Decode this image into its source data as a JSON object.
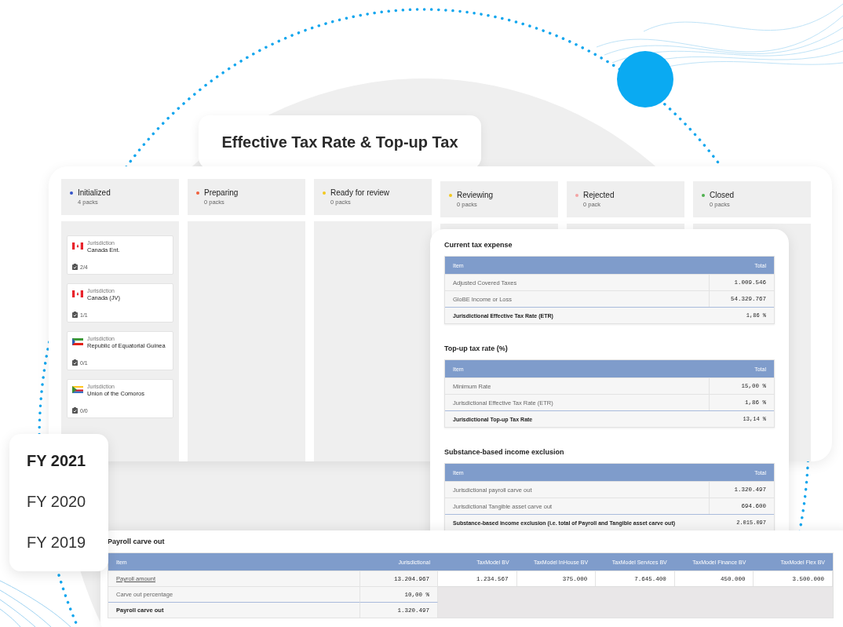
{
  "title": "Effective Tax Rate & Top-up Tax",
  "board": {
    "columns": [
      {
        "label": "Initialized",
        "count": "4 packs",
        "color": "#3352c8",
        "cards": [
          {
            "kind": "canada",
            "label": "Jurisdiction",
            "name": "Canada Ent.",
            "progress": "2/4"
          },
          {
            "kind": "canada",
            "label": "Jurisdiction",
            "name": "Canada (JV)",
            "progress": "1/1"
          },
          {
            "kind": "equatorial-guinea",
            "label": "Jurisdiction",
            "name": "Republic of Equatorial Guinea",
            "progress": "0/1"
          },
          {
            "kind": "comoros",
            "label": "Jurisdiction",
            "name": "Union of the Comoros",
            "progress": "0/0"
          }
        ]
      },
      {
        "label": "Preparing",
        "count": "0 packs",
        "color": "#f0603c"
      },
      {
        "label": "Ready for review",
        "count": "0 packs",
        "color": "#f2c81e"
      },
      {
        "label": "Reviewing",
        "count": "0 packs",
        "color": "#f2c81e"
      },
      {
        "label": "Rejected",
        "count": "0 pack",
        "color": "#f4a3a3"
      },
      {
        "label": "Closed",
        "count": "0 packs",
        "color": "#4fb04f"
      }
    ]
  },
  "sections": [
    {
      "title": "Current tax expense",
      "columns": [
        "Item",
        "Total"
      ],
      "rows": [
        {
          "kind": "normal",
          "item": "Adjusted Covered Taxes",
          "total": "1.009.546"
        },
        {
          "kind": "normal",
          "item": "GloBE Income or Loss",
          "total": "54.329.767"
        },
        {
          "kind": "total",
          "item": "Jurisdictional Effective Tax Rate (ETR)",
          "total": "1,86 %"
        }
      ]
    },
    {
      "title": "Top-up tax rate (%)",
      "columns": [
        "Item",
        "Total"
      ],
      "rows": [
        {
          "kind": "normal",
          "item": "Minimum Rate",
          "total": "15,00 %"
        },
        {
          "kind": "normal",
          "item": "Jurisdictional Effective Tax Rate (ETR)",
          "total": "1,86 %"
        },
        {
          "kind": "total",
          "item": "Jurisdictional Top-up Tax Rate",
          "total": "13,14 %"
        }
      ]
    },
    {
      "title": "Substance-based income exclusion",
      "columns": [
        "Item",
        "Total"
      ],
      "rows": [
        {
          "kind": "normal",
          "item": "Jurisdictional payroll carve out",
          "total": "1.320.497"
        },
        {
          "kind": "normal",
          "item": "Jurisdictional Tangible asset carve out",
          "total": "694.600"
        },
        {
          "kind": "total",
          "item": "Substance-based income exclusion (i.e. total of Payroll and Tangible asset carve out)",
          "total": "2.015.097"
        }
      ]
    }
  ],
  "years": [
    {
      "label": "FY 2021",
      "selected": true
    },
    {
      "label": "FY 2020",
      "selected": false
    },
    {
      "label": "FY 2019",
      "selected": false
    }
  ],
  "payroll": {
    "title": "Payroll carve out",
    "columns": [
      "Item",
      "Jurisdictional",
      "TaxModel BV",
      "TaxModel InHouse BV",
      "TaxModel Services BV",
      "TaxModel Finance BV",
      "TaxModel Flex BV"
    ],
    "rows": [
      {
        "kind": "link",
        "item": "Payroll amount",
        "values": [
          "13.204.967",
          "1.234.567",
          "375.000",
          "7.645.400",
          "450.000",
          "3.500.000"
        ]
      },
      {
        "kind": "normal",
        "item": "Carve out percentage",
        "values": [
          "10,00 %"
        ]
      },
      {
        "kind": "total",
        "item": "Payroll carve out",
        "values": [
          "1.320.497"
        ]
      }
    ]
  }
}
